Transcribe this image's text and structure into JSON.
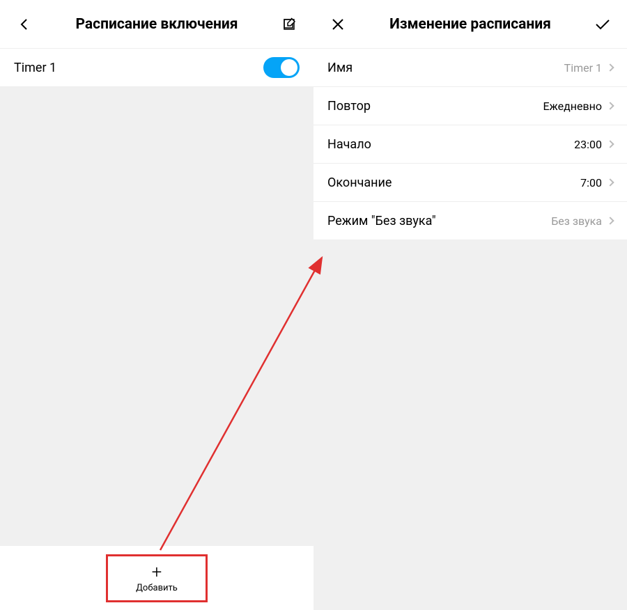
{
  "left": {
    "title": "Расписание включения",
    "timer": {
      "name": "Timer 1",
      "enabled": true
    },
    "add_label": "Добавить"
  },
  "right": {
    "title": "Изменение расписания",
    "rows": {
      "name": {
        "label": "Имя",
        "value": "Timer 1"
      },
      "repeat": {
        "label": "Повтор",
        "value": "Ежедневно"
      },
      "start": {
        "label": "Начало",
        "value": "23:00"
      },
      "end": {
        "label": "Окончание",
        "value": "7:00"
      },
      "silent": {
        "label": "Режим \"Без звука\"",
        "value": "Без звука"
      }
    }
  }
}
